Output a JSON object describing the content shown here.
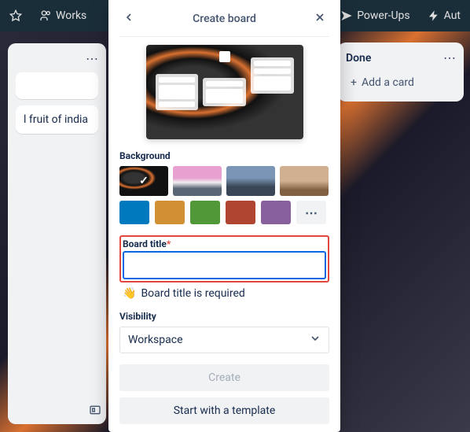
{
  "header": {
    "workspace": "Works",
    "powerups": "Power-Ups",
    "automation": "Aut"
  },
  "background_lists": {
    "left_card": "l fruit of india",
    "right_header": "Done",
    "add_card": "Add a card"
  },
  "modal": {
    "title": "Create board",
    "background_label": "Background",
    "board_title_label": "Board title",
    "board_title_value": "",
    "error_message": "Board title is required",
    "visibility_label": "Visibility",
    "visibility_value": "Workspace",
    "create_button": "Create",
    "template_button": "Start with a template",
    "colors": [
      "#0079bf",
      "#d29034",
      "#519839",
      "#b04632",
      "#89609e"
    ],
    "more_label": "⋯"
  }
}
